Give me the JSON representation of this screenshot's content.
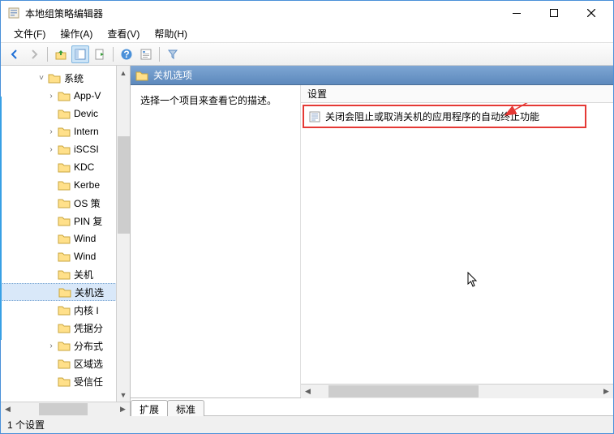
{
  "window": {
    "title": "本地组策略编辑器"
  },
  "menubar": {
    "file": "文件(F)",
    "action": "操作(A)",
    "view": "查看(V)",
    "help": "帮助(H)"
  },
  "tree": {
    "root_label": "系统",
    "items": [
      {
        "label": "App-V",
        "expand": ">",
        "indent": 2
      },
      {
        "label": "Devic",
        "expand": "",
        "indent": 2
      },
      {
        "label": "Intern",
        "expand": ">",
        "indent": 2
      },
      {
        "label": "iSCSI",
        "expand": ">",
        "indent": 2
      },
      {
        "label": "KDC",
        "expand": "",
        "indent": 2
      },
      {
        "label": "Kerbe",
        "expand": "",
        "indent": 2
      },
      {
        "label": "OS 策",
        "expand": "",
        "indent": 2
      },
      {
        "label": "PIN 复",
        "expand": "",
        "indent": 2
      },
      {
        "label": "Wind",
        "expand": "",
        "indent": 2
      },
      {
        "label": "Wind",
        "expand": "",
        "indent": 2
      },
      {
        "label": "关机",
        "expand": "",
        "indent": 2
      },
      {
        "label": "关机选",
        "expand": "",
        "indent": 2,
        "selected": true
      },
      {
        "label": "内核 I",
        "expand": "",
        "indent": 2
      },
      {
        "label": "凭据分",
        "expand": "",
        "indent": 2
      },
      {
        "label": "分布式",
        "expand": ">",
        "indent": 2
      },
      {
        "label": "区域选",
        "expand": "",
        "indent": 2
      },
      {
        "label": "受信任",
        "expand": "",
        "indent": 2
      }
    ]
  },
  "content": {
    "header": "关机选项",
    "description": "选择一个项目来查看它的描述。",
    "column_setting": "设置",
    "item": "关闭会阻止或取消关机的应用程序的自动终止功能"
  },
  "tabs": {
    "extended": "扩展",
    "standard": "标准"
  },
  "statusbar": {
    "text": "1 个设置"
  }
}
